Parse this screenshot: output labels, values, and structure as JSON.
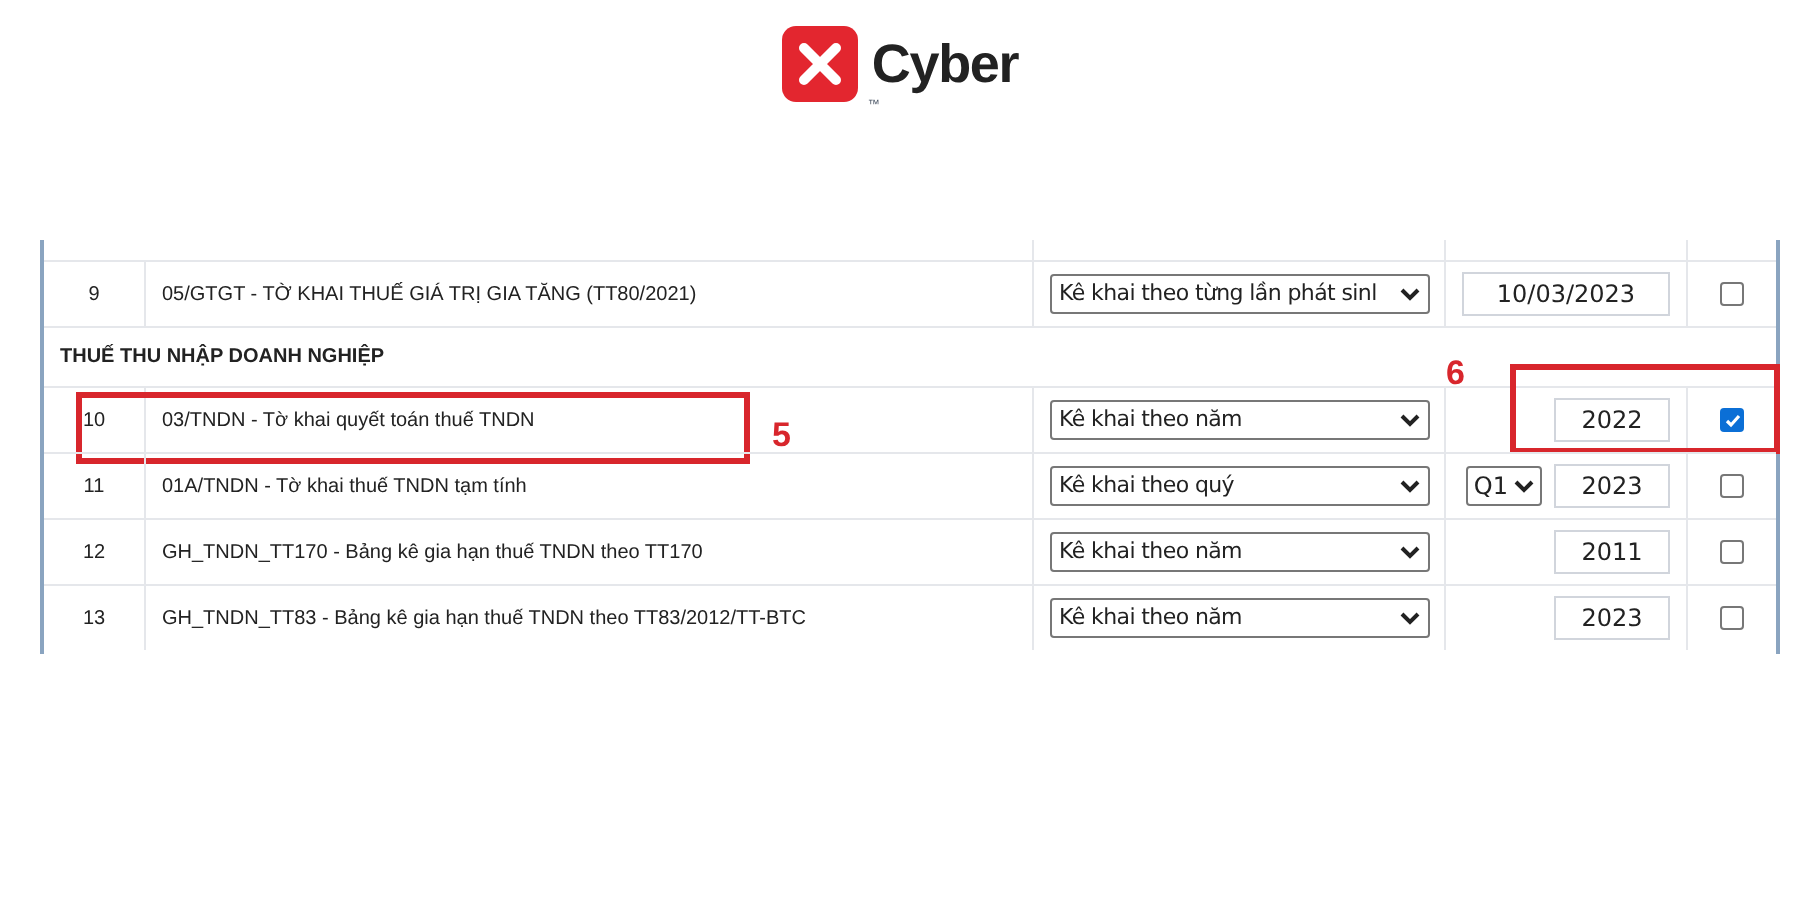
{
  "logo": {
    "text": "Cyber",
    "mark": "™"
  },
  "rows": [
    {
      "kind": "item",
      "no": "9",
      "name": "05/GTGT - TỜ KHAI THUẾ GIÁ TRỊ GIA TĂNG (TT80/2021)",
      "mode": "Kê khai theo từng lần phát sinl",
      "value": "10/03/2023",
      "checked": false
    },
    {
      "kind": "group",
      "name": "THUẾ THU NHẬP DOANH NGHIỆP"
    },
    {
      "kind": "item",
      "no": "10",
      "name": "03/TNDN - Tờ khai quyết toán thuế TNDN",
      "mode": "Kê khai theo năm",
      "value": "2022",
      "checked": true,
      "name_callout": "5",
      "value_callout": "6"
    },
    {
      "kind": "item",
      "no": "11",
      "name": "01A/TNDN - Tờ khai thuế TNDN tạm tính",
      "mode": "Kê khai theo quý",
      "quarter": "Q1",
      "value": "2023",
      "checked": false
    },
    {
      "kind": "item",
      "no": "12",
      "name": "GH_TNDN_TT170 - Bảng kê gia hạn thuế TNDN theo TT170",
      "mode": "Kê khai theo năm",
      "value": "2011",
      "checked": false
    },
    {
      "kind": "item",
      "no": "13",
      "name": "GH_TNDN_TT83 - Bảng kê gia hạn thuế TNDN theo TT83/2012/TT-BTC",
      "mode": "Kê khai theo năm",
      "value": "2023",
      "checked": false
    }
  ]
}
